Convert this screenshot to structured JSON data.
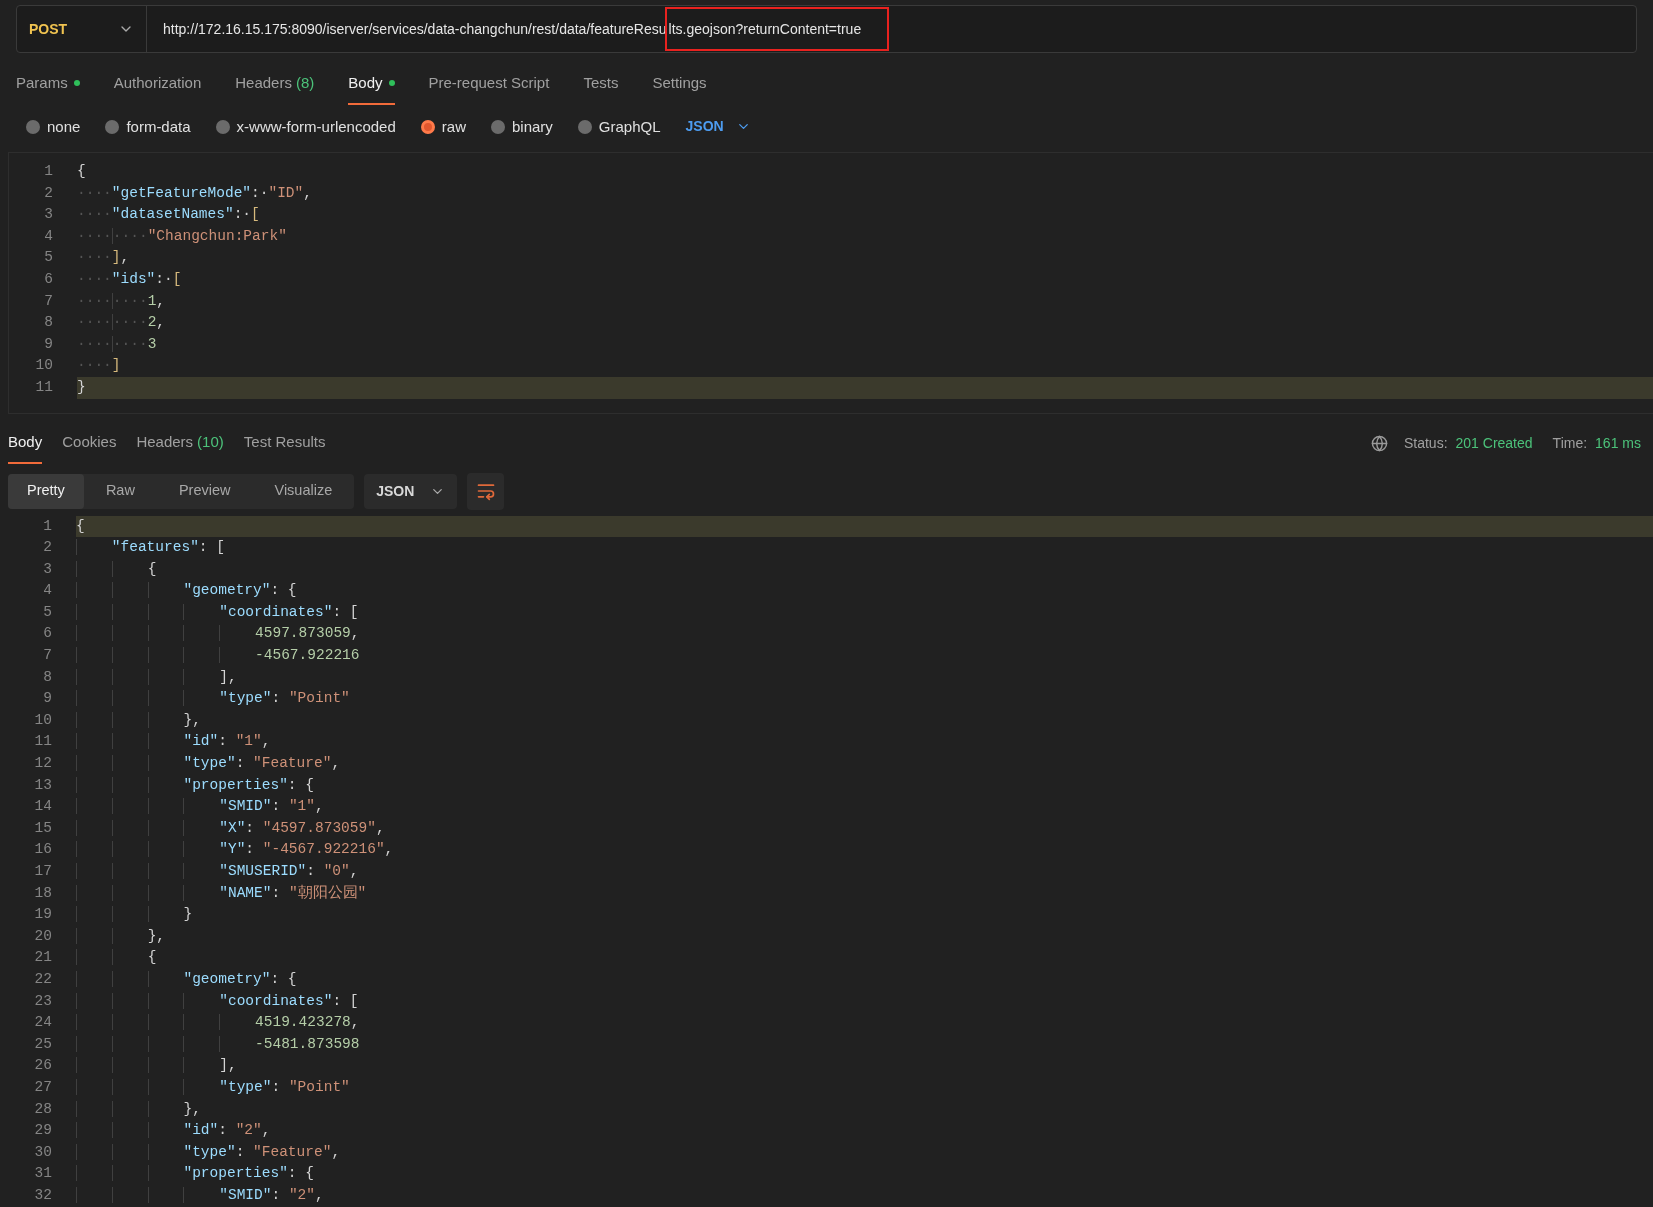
{
  "request": {
    "method": "POST",
    "url": [
      {
        "text": "http://172.16.15.175:8090/iserver/services/data-changchun/rest/data/featureResu",
        "boxed": false
      },
      {
        "text": "lts.geojson?returnContent=true",
        "boxed": true
      }
    ]
  },
  "request_tabs": [
    {
      "label": "Params",
      "dot": true,
      "selected": false
    },
    {
      "label": "Authorization",
      "dot": false,
      "selected": false
    },
    {
      "label": "Headers",
      "count": "(8)",
      "dot": false,
      "selected": false
    },
    {
      "label": "Body",
      "dot": true,
      "selected": true
    },
    {
      "label": "Pre-request Script",
      "dot": false,
      "selected": false
    },
    {
      "label": "Tests",
      "dot": false,
      "selected": false
    },
    {
      "label": "Settings",
      "dot": false,
      "selected": false
    }
  ],
  "body_types": [
    {
      "label": "none",
      "selected": false
    },
    {
      "label": "form-data",
      "selected": false
    },
    {
      "label": "x-www-form-urlencoded",
      "selected": false
    },
    {
      "label": "raw",
      "selected": true
    },
    {
      "label": "binary",
      "selected": false
    },
    {
      "label": "GraphQL",
      "selected": false
    }
  ],
  "body_language": "JSON",
  "request_body": [
    {
      "number": "1",
      "current": false,
      "tokens": [
        {
          "kind": "punct",
          "text": "{"
        }
      ]
    },
    {
      "number": "2",
      "lead": "····",
      "current": false,
      "tokens": [
        {
          "kind": "key",
          "text": "\"getFeatureMode\""
        },
        {
          "kind": "punct",
          "text": ":·"
        },
        {
          "kind": "string",
          "text": "\"ID\""
        },
        {
          "kind": "punct",
          "text": ","
        }
      ]
    },
    {
      "number": "3",
      "lead": "····",
      "current": false,
      "tokens": [
        {
          "kind": "key",
          "text": "\"datasetNames\""
        },
        {
          "kind": "punct",
          "text": ":·"
        },
        {
          "kind": "bracket",
          "text": "["
        }
      ]
    },
    {
      "number": "4",
      "lead": "········",
      "current": false,
      "tokens": [
        {
          "kind": "string",
          "text": "\"Changchun:Park\""
        }
      ]
    },
    {
      "number": "5",
      "lead": "····",
      "current": false,
      "tokens": [
        {
          "kind": "bracket",
          "text": "]"
        },
        {
          "kind": "punct",
          "text": ","
        }
      ]
    },
    {
      "number": "6",
      "lead": "····",
      "current": false,
      "tokens": [
        {
          "kind": "key",
          "text": "\"ids\""
        },
        {
          "kind": "punct",
          "text": ":·"
        },
        {
          "kind": "bracket",
          "text": "["
        }
      ]
    },
    {
      "number": "7",
      "lead": "········",
      "current": false,
      "tokens": [
        {
          "kind": "number",
          "text": "1"
        },
        {
          "kind": "punct",
          "text": ","
        }
      ]
    },
    {
      "number": "8",
      "lead": "········",
      "current": false,
      "tokens": [
        {
          "kind": "number",
          "text": "2"
        },
        {
          "kind": "punct",
          "text": ","
        }
      ]
    },
    {
      "number": "9",
      "lead": "········",
      "current": false,
      "tokens": [
        {
          "kind": "number",
          "text": "3"
        }
      ]
    },
    {
      "number": "10",
      "lead": "····",
      "current": false,
      "tokens": [
        {
          "kind": "bracket",
          "text": "]"
        }
      ]
    },
    {
      "number": "11",
      "current": true,
      "tokens": [
        {
          "kind": "punct",
          "text": "}"
        }
      ]
    }
  ],
  "response_tabs": [
    {
      "label": "Body",
      "selected": true
    },
    {
      "label": "Cookies",
      "selected": false
    },
    {
      "label": "Headers",
      "count": "(10)",
      "selected": false
    },
    {
      "label": "Test Results",
      "selected": false
    }
  ],
  "response_status": {
    "status_label": "Status:",
    "status": "201 Created",
    "time_label": "Time:",
    "time": "161 ms"
  },
  "view_modes": [
    {
      "label": "Pretty",
      "selected": true
    },
    {
      "label": "Raw",
      "selected": false
    },
    {
      "label": "Preview",
      "selected": false
    },
    {
      "label": "Visualize",
      "selected": false
    }
  ],
  "response_language": "JSON",
  "response_body": [
    {
      "number": "1",
      "current": true,
      "tokens": [
        {
          "kind": "punct",
          "text": "{"
        }
      ]
    },
    {
      "number": "2",
      "current": false,
      "tokens": [
        {
          "kind": "key",
          "text": "    \"features\""
        },
        {
          "kind": "punct",
          "text": ": ["
        }
      ]
    },
    {
      "number": "3",
      "current": false,
      "tokens": [
        {
          "kind": "punct",
          "text": "        {"
        }
      ]
    },
    {
      "number": "4",
      "current": false,
      "tokens": [
        {
          "kind": "key",
          "text": "            \"geometry\""
        },
        {
          "kind": "punct",
          "text": ": {"
        }
      ]
    },
    {
      "number": "5",
      "current": false,
      "tokens": [
        {
          "kind": "key",
          "text": "                \"coordinates\""
        },
        {
          "kind": "punct",
          "text": ": ["
        }
      ]
    },
    {
      "number": "6",
      "current": false,
      "tokens": [
        {
          "kind": "number",
          "text": "                    4597.873059"
        },
        {
          "kind": "punct",
          "text": ","
        }
      ]
    },
    {
      "number": "7",
      "current": false,
      "tokens": [
        {
          "kind": "number",
          "text": "                    -4567.922216"
        }
      ]
    },
    {
      "number": "8",
      "current": false,
      "tokens": [
        {
          "kind": "punct",
          "text": "                ],"
        }
      ]
    },
    {
      "number": "9",
      "current": false,
      "tokens": [
        {
          "kind": "key",
          "text": "                \"type\""
        },
        {
          "kind": "punct",
          "text": ": "
        },
        {
          "kind": "string",
          "text": "\"Point\""
        }
      ]
    },
    {
      "number": "10",
      "current": false,
      "tokens": [
        {
          "kind": "punct",
          "text": "            },"
        }
      ]
    },
    {
      "number": "11",
      "current": false,
      "tokens": [
        {
          "kind": "key",
          "text": "            \"id\""
        },
        {
          "kind": "punct",
          "text": ": "
        },
        {
          "kind": "string",
          "text": "\"1\""
        },
        {
          "kind": "punct",
          "text": ","
        }
      ]
    },
    {
      "number": "12",
      "current": false,
      "tokens": [
        {
          "kind": "key",
          "text": "            \"type\""
        },
        {
          "kind": "punct",
          "text": ": "
        },
        {
          "kind": "string",
          "text": "\"Feature\""
        },
        {
          "kind": "punct",
          "text": ","
        }
      ]
    },
    {
      "number": "13",
      "current": false,
      "tokens": [
        {
          "kind": "key",
          "text": "            \"properties\""
        },
        {
          "kind": "punct",
          "text": ": {"
        }
      ]
    },
    {
      "number": "14",
      "current": false,
      "tokens": [
        {
          "kind": "key",
          "text": "                \"SMID\""
        },
        {
          "kind": "punct",
          "text": ": "
        },
        {
          "kind": "string",
          "text": "\"1\""
        },
        {
          "kind": "punct",
          "text": ","
        }
      ]
    },
    {
      "number": "15",
      "current": false,
      "tokens": [
        {
          "kind": "key",
          "text": "                \"X\""
        },
        {
          "kind": "punct",
          "text": ": "
        },
        {
          "kind": "string",
          "text": "\"4597.873059\""
        },
        {
          "kind": "punct",
          "text": ","
        }
      ]
    },
    {
      "number": "16",
      "current": false,
      "tokens": [
        {
          "kind": "key",
          "text": "                \"Y\""
        },
        {
          "kind": "punct",
          "text": ": "
        },
        {
          "kind": "string",
          "text": "\"-4567.922216\""
        },
        {
          "kind": "punct",
          "text": ","
        }
      ]
    },
    {
      "number": "17",
      "current": false,
      "tokens": [
        {
          "kind": "key",
          "text": "                \"SMUSERID\""
        },
        {
          "kind": "punct",
          "text": ": "
        },
        {
          "kind": "string",
          "text": "\"0\""
        },
        {
          "kind": "punct",
          "text": ","
        }
      ]
    },
    {
      "number": "18",
      "current": false,
      "tokens": [
        {
          "kind": "key",
          "text": "                \"NAME\""
        },
        {
          "kind": "punct",
          "text": ": "
        },
        {
          "kind": "string",
          "text": "\"朝阳公园\""
        }
      ]
    },
    {
      "number": "19",
      "current": false,
      "tokens": [
        {
          "kind": "punct",
          "text": "            }"
        }
      ]
    },
    {
      "number": "20",
      "current": false,
      "tokens": [
        {
          "kind": "punct",
          "text": "        },"
        }
      ]
    },
    {
      "number": "21",
      "current": false,
      "tokens": [
        {
          "kind": "punct",
          "text": "        {"
        }
      ]
    },
    {
      "number": "22",
      "current": false,
      "tokens": [
        {
          "kind": "key",
          "text": "            \"geometry\""
        },
        {
          "kind": "punct",
          "text": ": {"
        }
      ]
    },
    {
      "number": "23",
      "current": false,
      "tokens": [
        {
          "kind": "key",
          "text": "                \"coordinates\""
        },
        {
          "kind": "punct",
          "text": ": ["
        }
      ]
    },
    {
      "number": "24",
      "current": false,
      "tokens": [
        {
          "kind": "number",
          "text": "                    4519.423278"
        },
        {
          "kind": "punct",
          "text": ","
        }
      ]
    },
    {
      "number": "25",
      "current": false,
      "tokens": [
        {
          "kind": "number",
          "text": "                    -5481.873598"
        }
      ]
    },
    {
      "number": "26",
      "current": false,
      "tokens": [
        {
          "kind": "punct",
          "text": "                ],"
        }
      ]
    },
    {
      "number": "27",
      "current": false,
      "tokens": [
        {
          "kind": "key",
          "text": "                \"type\""
        },
        {
          "kind": "punct",
          "text": ": "
        },
        {
          "kind": "string",
          "text": "\"Point\""
        }
      ]
    },
    {
      "number": "28",
      "current": false,
      "tokens": [
        {
          "kind": "punct",
          "text": "            },"
        }
      ]
    },
    {
      "number": "29",
      "current": false,
      "tokens": [
        {
          "kind": "key",
          "text": "            \"id\""
        },
        {
          "kind": "punct",
          "text": ": "
        },
        {
          "kind": "string",
          "text": "\"2\""
        },
        {
          "kind": "punct",
          "text": ","
        }
      ]
    },
    {
      "number": "30",
      "current": false,
      "tokens": [
        {
          "kind": "key",
          "text": "            \"type\""
        },
        {
          "kind": "punct",
          "text": ": "
        },
        {
          "kind": "string",
          "text": "\"Feature\""
        },
        {
          "kind": "punct",
          "text": ","
        }
      ]
    },
    {
      "number": "31",
      "current": false,
      "tokens": [
        {
          "kind": "key",
          "text": "            \"properties\""
        },
        {
          "kind": "punct",
          "text": ": {"
        }
      ]
    },
    {
      "number": "32",
      "current": false,
      "tokens": [
        {
          "kind": "key",
          "text": "                \"SMID\""
        },
        {
          "kind": "punct",
          "text": ": "
        },
        {
          "kind": "string",
          "text": "\"2\""
        },
        {
          "kind": "punct",
          "text": ","
        }
      ]
    }
  ]
}
